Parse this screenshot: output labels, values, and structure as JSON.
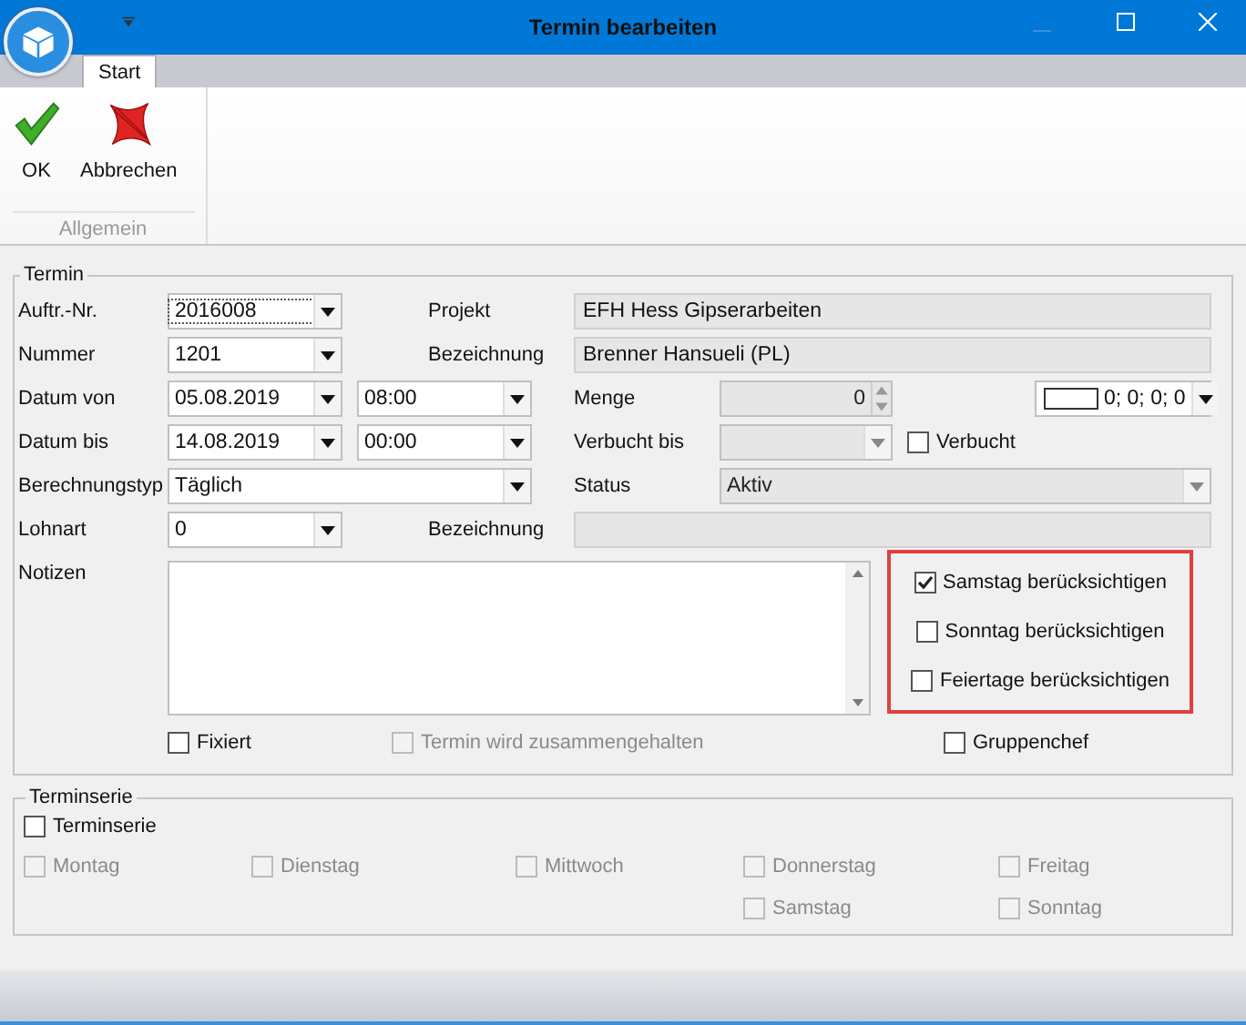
{
  "window": {
    "title": "Termin bearbeiten"
  },
  "ribbon": {
    "tabs": [
      {
        "label": "Start",
        "selected": true
      }
    ],
    "buttons": [
      {
        "label": "OK",
        "kind": "ok"
      },
      {
        "label": "Abbrechen",
        "kind": "cancel"
      }
    ],
    "group": "Allgemein"
  },
  "termin": {
    "legend": "Termin",
    "auftrag": {
      "label": "Auftr.-Nr.",
      "value": "2016008"
    },
    "nummer": {
      "label": "Nummer",
      "value": "1201"
    },
    "projekt": {
      "label": "Projekt",
      "value": "EFH Hess Gipserarbeiten"
    },
    "bezeichnung": {
      "label": "Bezeichnung",
      "value": "Brenner Hansueli (PL)"
    },
    "datum_von": {
      "label": "Datum von",
      "date": "05.08.2019",
      "time": "08:00"
    },
    "datum_bis": {
      "label": "Datum bis",
      "date": "14.08.2019",
      "time": "00:00"
    },
    "menge": {
      "label": "Menge",
      "value": "0",
      "disabled": true
    },
    "farbe": {
      "value": "0; 0; 0; 0"
    },
    "verbucht_bis": {
      "label": "Verbucht bis",
      "disabled": true
    },
    "verbucht": {
      "label": "Verbucht",
      "checked": false,
      "disabled": false
    },
    "berechnungstyp": {
      "label": "Berechnungstyp",
      "value": "Täglich"
    },
    "status": {
      "label": "Status",
      "value": "Aktiv",
      "disabled": true
    },
    "lohnart": {
      "label": "Lohnart",
      "value": "0"
    },
    "lohnart_bezeichnung": {
      "label": "Bezeichnung"
    },
    "notizen": {
      "label": "Notizen"
    },
    "weekend_options": [
      {
        "label": "Samstag berücksichtigen",
        "checked": true,
        "disabled": false
      },
      {
        "label": "Sonntag berücksichtigen",
        "checked": false,
        "disabled": false
      },
      {
        "label": "Feiertage berücksichtigen",
        "checked": false,
        "disabled": false
      }
    ],
    "flags": [
      {
        "label": "Fixiert",
        "checked": false,
        "disabled": false
      },
      {
        "label": "Termin wird zusammengehalten",
        "checked": false,
        "disabled": true
      },
      {
        "label": "Gruppenchef",
        "checked": false,
        "disabled": false
      }
    ]
  },
  "terminserie": {
    "legend": "Terminserie",
    "enabled": {
      "label": "Terminserie",
      "checked": false,
      "disabled": false
    },
    "days": [
      {
        "label": "Montag",
        "checked": false,
        "disabled": true
      },
      {
        "label": "Dienstag",
        "checked": false,
        "disabled": true
      },
      {
        "label": "Mittwoch",
        "checked": false,
        "disabled": true
      },
      {
        "label": "Donnerstag",
        "checked": false,
        "disabled": true
      },
      {
        "label": "Freitag",
        "checked": false,
        "disabled": true
      },
      {
        "label": "Samstag",
        "checked": false,
        "disabled": true
      },
      {
        "label": "Sonntag",
        "checked": false,
        "disabled": true
      }
    ]
  }
}
